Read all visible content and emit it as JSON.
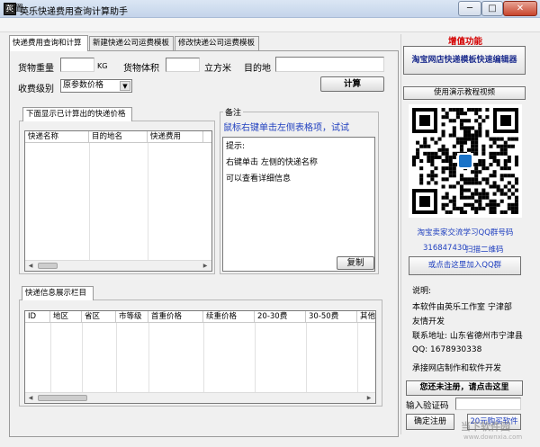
{
  "window": {
    "title": "英乐快递费用查询计算助手",
    "minimize": "─",
    "maximize": "□",
    "close": "✕"
  },
  "menu": {
    "settings": "设置"
  },
  "tabs": [
    {
      "label": "快递费用查询和计算",
      "active": true
    },
    {
      "label": "新建快递公司运费模板",
      "active": false
    },
    {
      "label": "修改快递公司运费模板",
      "active": false
    }
  ],
  "form": {
    "weight_label": "货物重量",
    "weight_unit": "KG",
    "weight_value": "",
    "volume_label": "货物体积",
    "volume_unit": "立方米",
    "volume_value": "",
    "dest_label": "目的地",
    "dest_value": "",
    "level_label": "收费级别",
    "level_selected": "原参数价格",
    "calc_button": "计算"
  },
  "results": {
    "tab_label": "下面显示已计算出的快递价格",
    "columns": [
      "快递名称",
      "目的地名",
      "快递费用"
    ]
  },
  "note": {
    "title": "备注",
    "hint": "鼠标右键单击左侧表格项，试试",
    "lines": [
      "提示:",
      "右键单击  左侧的快递名称",
      "可以查看详细信息"
    ],
    "copy_button": "复制"
  },
  "info": {
    "tab_label": "快递信息展示栏目",
    "columns": [
      "ID",
      "地区",
      "省区",
      "市等级",
      "首重价格",
      "续重价格",
      "20-30费",
      "30-50费",
      "其他"
    ]
  },
  "sidebar": {
    "promo_label": "增值功能",
    "editor_button": "淘宝网店快递模板快速编辑器",
    "video_button": "使用演示教程视频",
    "qq_group_label": "淘宝卖家交流学习QQ群号码",
    "qq_number": "316847430",
    "scan_label": "扫描二维码",
    "join_qq_button": "或点击这里加入QQ群",
    "about_title": "说明:",
    "about_line1": "本软件由英乐工作室  宁津部",
    "about_line2": "友情开发",
    "address": "联系地址: 山东省德州市宁津县",
    "qq": "QQ: 1678930338",
    "service": "承接网店制作和软件开发",
    "register_notice": "您还未注册，请点击这里",
    "verify_label": "输入验证码",
    "verify_value": "",
    "confirm_button": "确定注册",
    "buy_button": "20元购买软件"
  },
  "watermark": {
    "text": "当下软件园",
    "url": "www.downxia.com"
  }
}
